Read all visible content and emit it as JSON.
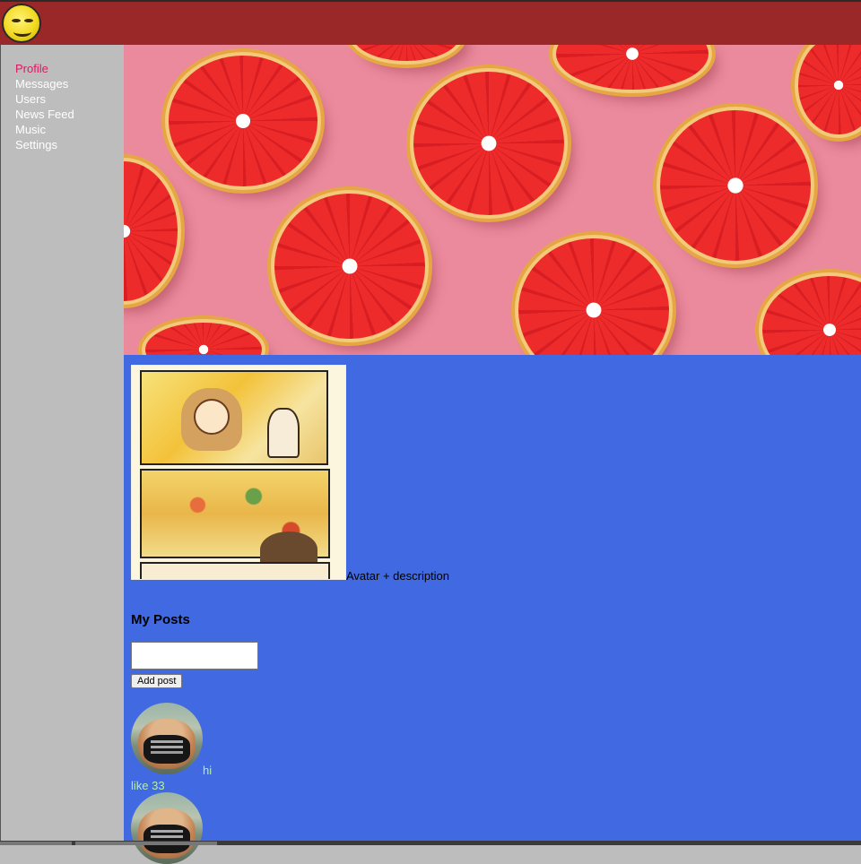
{
  "nav": {
    "items": [
      {
        "label": "Profile",
        "active": true
      },
      {
        "label": "Messages"
      },
      {
        "label": "Users"
      },
      {
        "label": "News Feed"
      },
      {
        "label": "Music"
      },
      {
        "label": "Settings"
      }
    ]
  },
  "profile": {
    "avatar_description": "Avatar + description"
  },
  "posts": {
    "title": "My Posts",
    "input_value": "",
    "add_button_label": "Add post",
    "items": [
      {
        "text": "hi",
        "likes": "like 33"
      },
      {
        "text": "",
        "likes": ""
      }
    ]
  },
  "colors": {
    "header": "#9b2828",
    "sidebar": "#bdbdbd",
    "content": "#4169e1",
    "nav_active": "#d81b60",
    "post_text": "#b6f0a0"
  }
}
